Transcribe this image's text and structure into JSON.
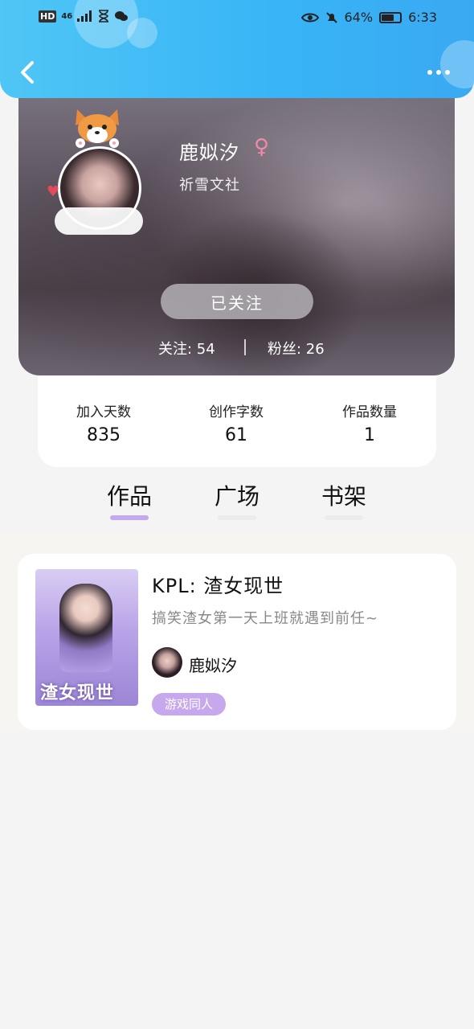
{
  "status_bar": {
    "left_chip": "HD",
    "network": "46",
    "battery_percent": "64%",
    "time": "6:33"
  },
  "nav": {
    "back_icon": "chevron-left-icon",
    "more_icon": "more-horizontal-icon"
  },
  "profile": {
    "name": "鹿姒汐",
    "gender_symbol": "♀",
    "organization": "祈雪文社",
    "follow_button": "已关注",
    "following_label": "关注: 54",
    "fans_label": "粉丝: 26"
  },
  "stats": [
    {
      "label": "加入天数",
      "value": "835"
    },
    {
      "label": "创作字数",
      "value": "61"
    },
    {
      "label": "作品数量",
      "value": "1"
    }
  ],
  "tabs": [
    {
      "label": "作品",
      "active": true
    },
    {
      "label": "广场",
      "active": false
    },
    {
      "label": "书架",
      "active": false
    }
  ],
  "colors": {
    "topbar": "#3fb8f5",
    "tab_indicator_active": "#c6a8ee",
    "tab_indicator_inactive": "#ececec",
    "tag_bg": "#c8a8ec"
  },
  "works": [
    {
      "cover_text": "渣女现世",
      "title": "KPL: 渣女现世",
      "description": "搞笑渣女第一天上班就遇到前任~",
      "author": "鹿姒汐",
      "tag": "游戏同人"
    }
  ]
}
